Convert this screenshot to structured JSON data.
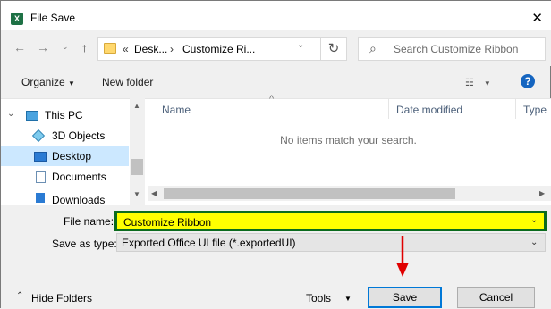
{
  "window": {
    "title": "File Save",
    "app_icon_letter": "X"
  },
  "nav": {
    "breadcrumb_prefix": "«",
    "crumbs": [
      "Desk...",
      "Customize Ri..."
    ],
    "search_placeholder": "Search Customize Ribbon"
  },
  "toolbar": {
    "organize": "Organize",
    "new_folder": "New folder"
  },
  "sidebar": {
    "items": [
      {
        "label": "This PC"
      },
      {
        "label": "3D Objects"
      },
      {
        "label": "Desktop"
      },
      {
        "label": "Documents"
      },
      {
        "label": "Downloads"
      }
    ]
  },
  "files": {
    "columns": [
      "Name",
      "Date modified",
      "Type"
    ],
    "empty_message": "No items match your search."
  },
  "form": {
    "file_name_label": "File name:",
    "file_name_value": "Customize Ribbon",
    "save_type_label": "Save as type:",
    "save_type_value": "Exported Office UI file (*.exportedUI)"
  },
  "footer": {
    "hide_folders": "Hide Folders",
    "tools": "Tools",
    "save": "Save",
    "cancel": "Cancel"
  },
  "colors": {
    "excel_green": "#1e7145",
    "highlight_yellow": "#ffff00",
    "highlight_border": "#0b6b1e",
    "annotation_red": "#e00000",
    "accent_blue": "#0078d7"
  }
}
